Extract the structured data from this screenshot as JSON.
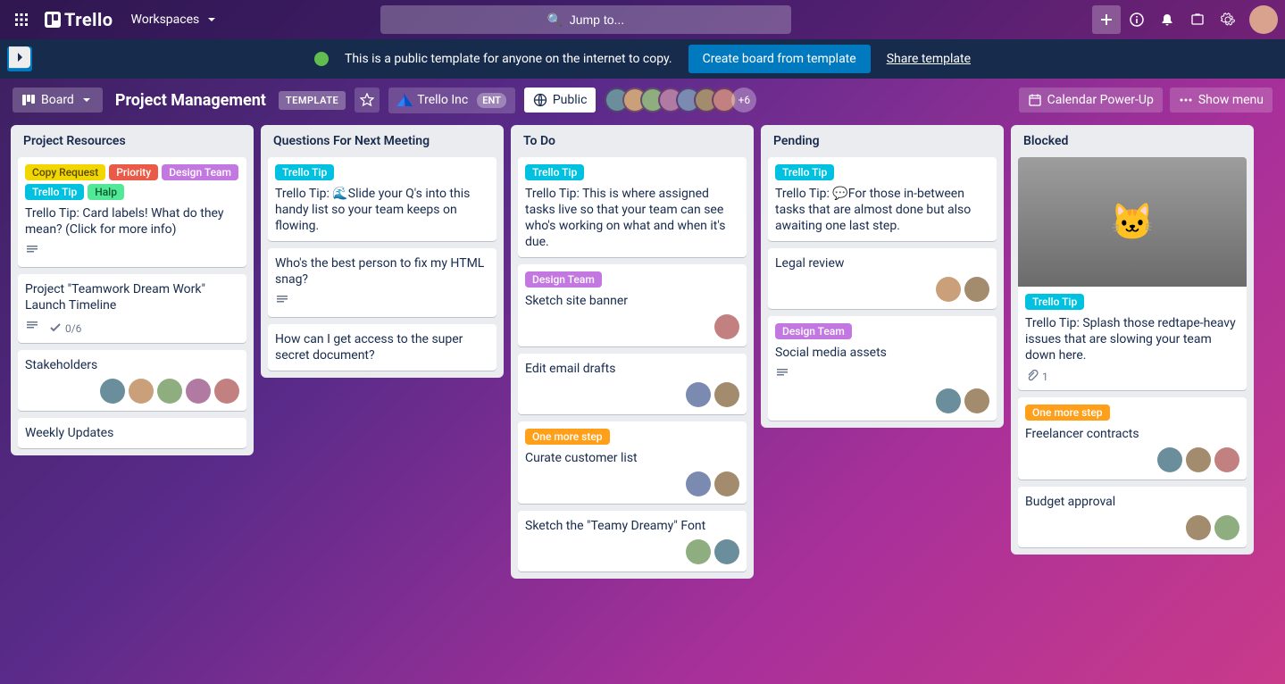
{
  "nav": {
    "brand": "Trello",
    "workspaces_label": "Workspaces",
    "search_placeholder": "🔍  Jump to..."
  },
  "banner": {
    "message": "This is a public template for anyone on the internet to copy.",
    "create_label": "Create board from template",
    "share_label": "Share template"
  },
  "board_header": {
    "view_label": "Board",
    "title": "Project Management",
    "template_badge": "TEMPLATE",
    "org_name": "Trello Inc",
    "org_tier": "ENT",
    "visibility": "Public",
    "more_members": "+6",
    "calendar_label": "Calendar Power-Up",
    "show_menu_label": "Show menu"
  },
  "label_names": {
    "copy_request": "Copy Request",
    "priority": "Priority",
    "design_team": "Design Team",
    "trello_tip": "Trello Tip",
    "halp": "Halp",
    "one_more_step": "One more step"
  },
  "lists": [
    {
      "title": "Project Resources",
      "cards": [
        {
          "labels": [
            "copy_request",
            "priority",
            "design_team",
            "trello_tip",
            "halp"
          ],
          "text": "Trello Tip: Card labels! What do they mean? (Click for more info)",
          "has_desc": true
        },
        {
          "text": "Project \"Teamwork Dream Work\" Launch Timeline",
          "has_desc": true,
          "checklist": "0/6"
        },
        {
          "text": "Stakeholders",
          "members": [
            "c1",
            "c2",
            "c3",
            "c4",
            "c7"
          ]
        },
        {
          "text": "Weekly Updates"
        }
      ]
    },
    {
      "title": "Questions For Next Meeting",
      "cards": [
        {
          "labels": [
            "trello_tip"
          ],
          "text": "Trello Tip: 🌊Slide your Q's into this handy list so your team keeps on flowing."
        },
        {
          "text": "Who's the best person to fix my HTML snag?",
          "has_desc": true
        },
        {
          "text": "How can I get access to the super secret document?"
        }
      ]
    },
    {
      "title": "To Do",
      "cards": [
        {
          "labels": [
            "trello_tip"
          ],
          "text": "Trello Tip: This is where assigned tasks live so that your team can see who's working on what and when it's due."
        },
        {
          "labels": [
            "design_team"
          ],
          "text": "Sketch site banner",
          "members": [
            "c7"
          ]
        },
        {
          "text": "Edit email drafts",
          "members": [
            "c5",
            "c6"
          ]
        },
        {
          "labels": [
            "one_more_step"
          ],
          "text": "Curate customer list",
          "members": [
            "c5",
            "c6"
          ]
        },
        {
          "text": "Sketch the \"Teamy Dreamy\" Font",
          "members": [
            "c3",
            "c1"
          ]
        }
      ]
    },
    {
      "title": "Pending",
      "cards": [
        {
          "labels": [
            "trello_tip"
          ],
          "text": "Trello Tip: 💬For those in-between tasks that are almost done but also awaiting one last step."
        },
        {
          "text": "Legal review",
          "members": [
            "c2",
            "c6"
          ]
        },
        {
          "labels": [
            "design_team"
          ],
          "text": "Social media assets",
          "has_desc": true,
          "members": [
            "c1",
            "c6"
          ]
        }
      ]
    },
    {
      "title": "Blocked",
      "cards": [
        {
          "cover": true,
          "labels": [
            "trello_tip"
          ],
          "text": "Trello Tip: Splash those redtape-heavy issues that are slowing your team down here.",
          "attachments": "1"
        },
        {
          "labels": [
            "one_more_step"
          ],
          "text": "Freelancer contracts",
          "members": [
            "c1",
            "c6",
            "c7"
          ]
        },
        {
          "text": "Budget approval",
          "members": [
            "c6",
            "c3"
          ]
        }
      ]
    }
  ]
}
